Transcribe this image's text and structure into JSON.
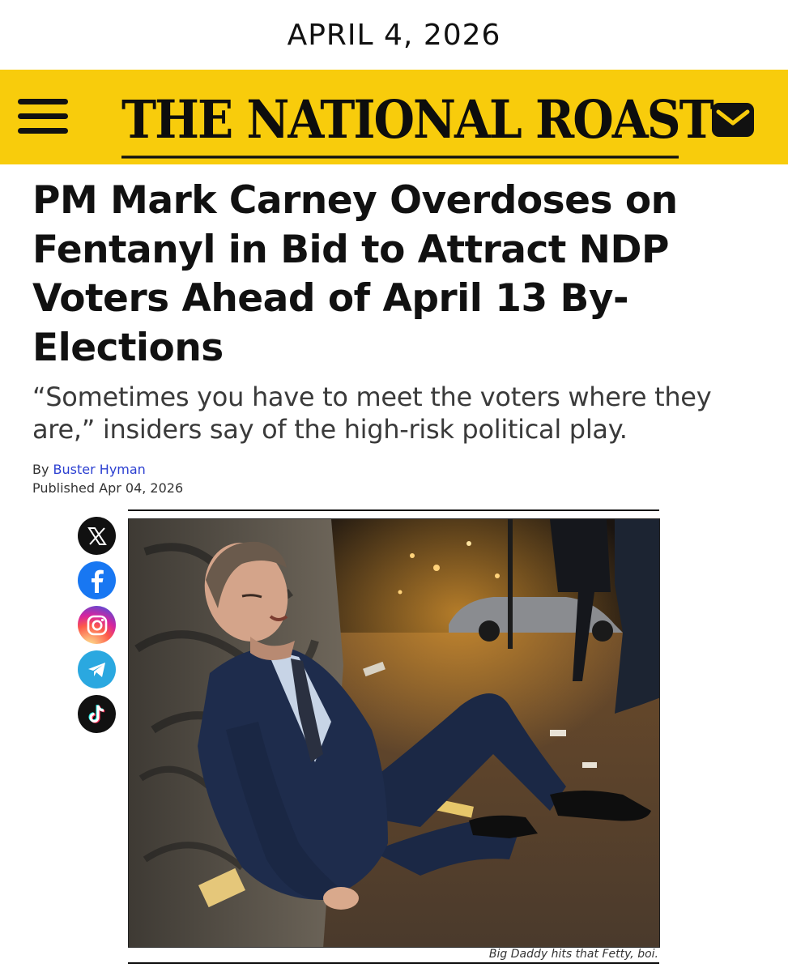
{
  "date": "APRIL 4, 2026",
  "masthead": {
    "brand": "THE NATIONAL ROAST",
    "menu_icon": "hamburger-menu-icon",
    "mail_icon": "envelope-icon",
    "background_color": "#f8cc0c"
  },
  "article": {
    "headline": "PM Mark Carney Overdoses on Fentanyl in Bid to Attract NDP Voters Ahead of April 13 By-Elections",
    "subhead": "“Sometimes you have to meet the voters where they are,” insiders say of the high-risk political play.",
    "byline_prefix": "By",
    "author": "Buster Hyman",
    "published": "Published Apr 04, 2026",
    "image_caption": "Big Daddy hits that Fetty, boi."
  },
  "share_icons": [
    "x-icon",
    "facebook-icon",
    "instagram-icon",
    "telegram-icon",
    "tiktok-icon"
  ],
  "colors": {
    "accent": "#f8cc0c",
    "link": "#2b3fd1",
    "facebook": "#1877f2",
    "telegram": "#2aa8e0"
  }
}
